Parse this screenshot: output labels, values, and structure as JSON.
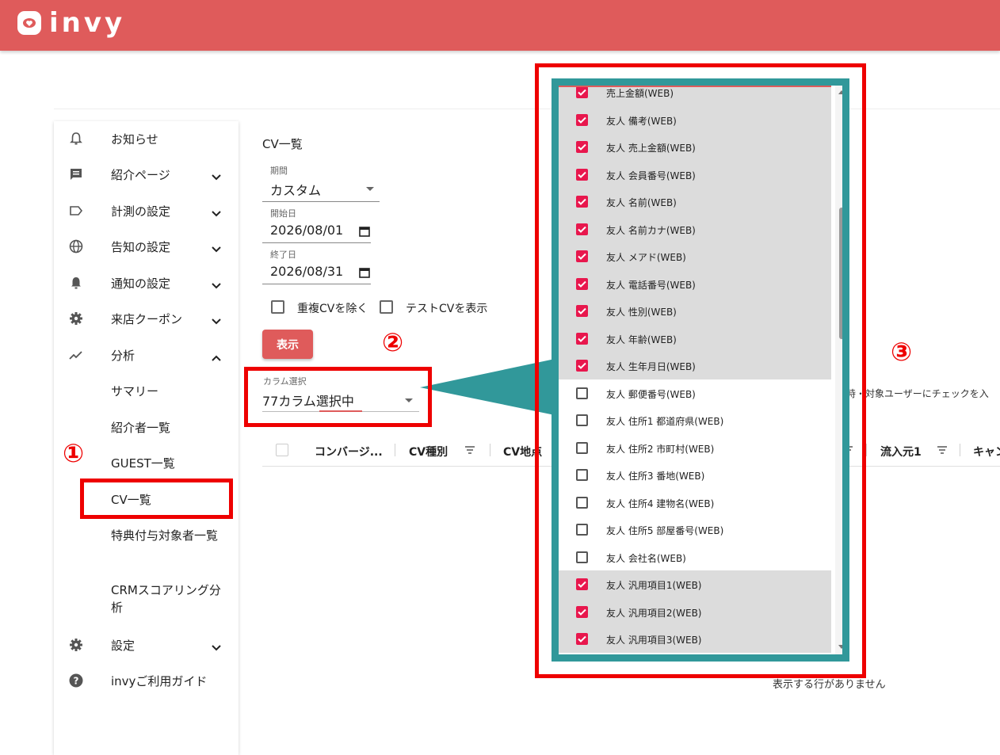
{
  "app": {
    "logo_text": "invy"
  },
  "sidebar": {
    "items": [
      {
        "label": "お知らせ",
        "icon": "bell-outline-icon"
      },
      {
        "label": "紹介ページ",
        "icon": "message-icon"
      },
      {
        "label": "計測の設定",
        "icon": "label-icon"
      },
      {
        "label": "告知の設定",
        "icon": "globe-icon"
      },
      {
        "label": "通知の設定",
        "icon": "bell-icon"
      },
      {
        "label": "来店クーポン",
        "icon": "gear-icon"
      },
      {
        "label": "分析",
        "icon": "trend-icon"
      }
    ],
    "sub_items": [
      "サマリー",
      "紹介者一覧",
      "GUEST一覧",
      "CV一覧",
      "特典付与対象者一覧",
      "CRMスコアリング分析"
    ],
    "bottom_items": [
      {
        "label": "設定",
        "icon": "gear-icon"
      },
      {
        "label": "invyご利用ガイド",
        "icon": "help-icon"
      }
    ]
  },
  "main": {
    "title": "CV一覧",
    "period_label": "期間",
    "period_value": "カスタム",
    "start_label": "開始日",
    "start_value": "2026/08/01",
    "end_label": "終了日",
    "end_value": "2026/08/31",
    "dedupe_label": "重複CVを除く",
    "test_label": "テストCVを表示",
    "show_button": "表示",
    "column_select_label": "カラム選択",
    "column_select_value": "77カラム選択中",
    "hint_text": "時・対象ユーザーにチェックを入",
    "table_headers": [
      "コンバージ...",
      "CV種別",
      "CV地点",
      "流入元1",
      "キャン"
    ],
    "empty_message": "表示する行がありません"
  },
  "dropdown": {
    "options": [
      {
        "label": "売上金額(WEB)",
        "checked": true
      },
      {
        "label": "友人 備考(WEB)",
        "checked": true
      },
      {
        "label": "友人 売上金額(WEB)",
        "checked": true
      },
      {
        "label": "友人 会員番号(WEB)",
        "checked": true
      },
      {
        "label": "友人 名前(WEB)",
        "checked": true
      },
      {
        "label": "友人 名前カナ(WEB)",
        "checked": true
      },
      {
        "label": "友人 メアド(WEB)",
        "checked": true
      },
      {
        "label": "友人 電話番号(WEB)",
        "checked": true
      },
      {
        "label": "友人 性別(WEB)",
        "checked": true
      },
      {
        "label": "友人 年齢(WEB)",
        "checked": true
      },
      {
        "label": "友人 生年月日(WEB)",
        "checked": true
      },
      {
        "label": "友人 郵便番号(WEB)",
        "checked": false
      },
      {
        "label": "友人 住所1 都道府県(WEB)",
        "checked": false
      },
      {
        "label": "友人 住所2 市町村(WEB)",
        "checked": false
      },
      {
        "label": "友人 住所3 番地(WEB)",
        "checked": false
      },
      {
        "label": "友人 住所4 建物名(WEB)",
        "checked": false
      },
      {
        "label": "友人 住所5 部屋番号(WEB)",
        "checked": false
      },
      {
        "label": "友人 会社名(WEB)",
        "checked": false
      },
      {
        "label": "友人 汎用項目1(WEB)",
        "checked": true
      },
      {
        "label": "友人 汎用項目2(WEB)",
        "checked": true
      },
      {
        "label": "友人 汎用項目3(WEB)",
        "checked": true
      }
    ]
  },
  "annotations": {
    "badge1": "①",
    "badge2": "②",
    "badge3": "③"
  },
  "colors": {
    "brand": "#df5b5b",
    "highlight": "#ee0000",
    "teal": "#31989a",
    "check": "#e8174d"
  }
}
